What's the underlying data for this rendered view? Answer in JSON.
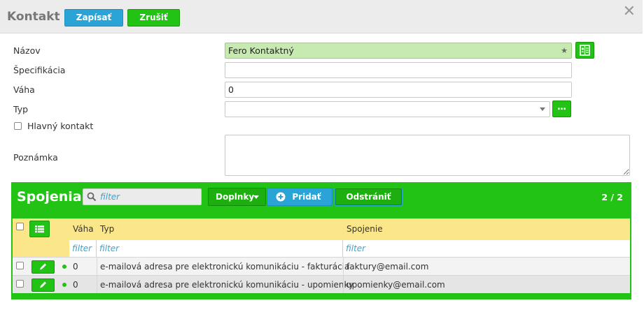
{
  "header": {
    "title": "Kontakt",
    "save_label": "Zapísať",
    "cancel_label": "Zrušiť"
  },
  "form": {
    "name_label": "Názov",
    "name_value": "Fero Kontaktný",
    "spec_label": "Špecifikácia",
    "spec_value": "",
    "weight_label": "Váha",
    "weight_value": "0",
    "type_label": "Typ",
    "type_value": "",
    "main_contact_label": "Hlavný kontakt",
    "note_label": "Poznámka",
    "note_value": ""
  },
  "grid": {
    "title": "Spojenia",
    "filter_placeholder": "filter",
    "extras_label": "Doplnky",
    "add_label": "Pridať",
    "remove_label": "Odstrániť",
    "count": "2 / 2",
    "columns": {
      "weight": "Váha",
      "type": "Typ",
      "connection": "Spojenie"
    },
    "filters": {
      "weight": "filter",
      "type": "filter",
      "connection": "filter"
    },
    "rows": [
      {
        "weight": "0",
        "type": "e-mailová adresa pre elektronickú komunikáciu - fakturácia",
        "connection": "faktury@email.com"
      },
      {
        "weight": "0",
        "type": "e-mailová adresa pre elektronickú komunikáciu - upomienky",
        "connection": "upomienky@email.com"
      }
    ]
  },
  "colors": {
    "green": "#22c314",
    "blue": "#2aa3d6",
    "header_yellow": "#fbe68a",
    "name_field": "#c7eab0"
  },
  "icons": [
    "close-icon",
    "star-icon",
    "address-book-icon",
    "ellipsis-icon",
    "search-icon",
    "dropdown-caret-icon",
    "plus-circle-icon",
    "list-icon",
    "pencil-icon",
    "status-dot-icon"
  ]
}
